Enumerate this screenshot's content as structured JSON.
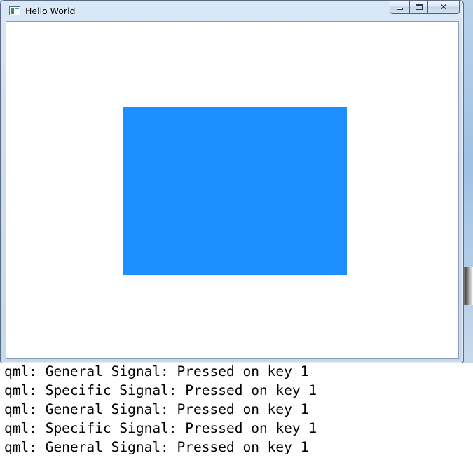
{
  "window": {
    "title": "Hello World",
    "content_rect_color": "#1E8FFF"
  },
  "console": {
    "lines": [
      "qml: General Signal: Pressed on key 1",
      "qml: Specific Signal: Pressed on key 1",
      "qml: General Signal: Pressed on key 1",
      "qml: Specific Signal: Pressed on key 1",
      "qml: General Signal: Pressed on key 1"
    ]
  },
  "caption_buttons": {
    "minimize_icon": "minimize-icon",
    "maximize_icon": "maximize-icon",
    "close_icon": "close-icon"
  }
}
